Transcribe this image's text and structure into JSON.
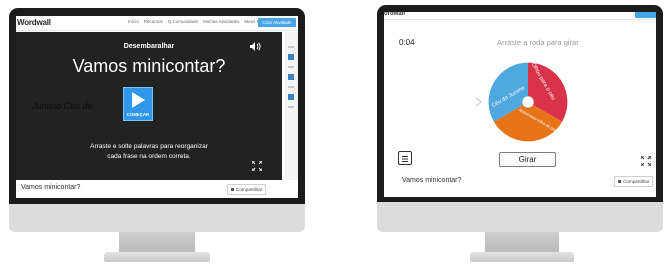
{
  "left_screen": {
    "logo": "Wordwall",
    "nav": [
      "Início",
      "Recursos",
      "Q Comunidade",
      "Minhas Atividades",
      "Meus Resultados"
    ],
    "create_button": "Criar Atividade",
    "activity_type": "Desembaralhar",
    "title": "Vamos minicontar?",
    "ghost_words": "Jumino  Céu  de",
    "start_label": "COMEÇAR",
    "instruction_line1": "Arraste e solte palavras para reorganizar",
    "instruction_line2": "cada frase na ordem correta.",
    "footer_title": "Vamos minicontar?",
    "share_label": "Compartilhar"
  },
  "right_screen": {
    "logo": "ordwall",
    "timer": "0:04",
    "prompt": "Arraste a roda para girar",
    "wheel_segments": [
      {
        "label": "Olhou para o céu",
        "color": "#d9334a"
      },
      {
        "label": "Atravessou trilha de pedrinhas",
        "color": "#e8741a"
      },
      {
        "label": "Céu do Jumino",
        "color": "#4fa8e0"
      }
    ],
    "spin_button": "Girar",
    "footer_title": "Vamos minicontar?",
    "share_label": "Compartilhar"
  },
  "colors": {
    "bezel": "#1b1b1b",
    "stage": "#222222",
    "accent_blue": "#2f97e8"
  }
}
